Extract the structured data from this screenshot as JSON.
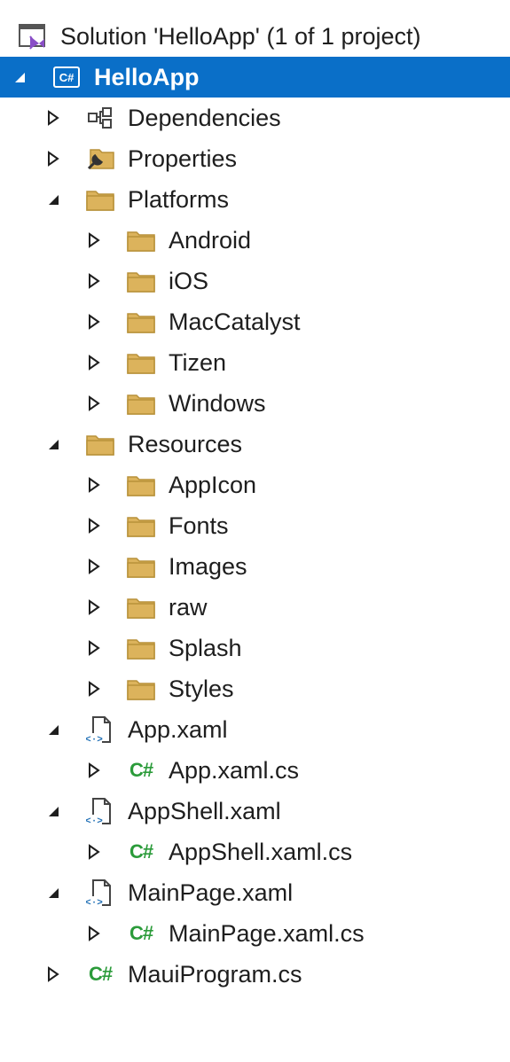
{
  "colors": {
    "selection": "#0a6fc8",
    "folder": "#dcb35c",
    "folder_edge": "#b8913a",
    "csharp": "#2b9b3a",
    "text": "#1e1e1e"
  },
  "tree": [
    {
      "label": "Solution 'HelloApp' (1 of 1 project)",
      "icon": "solution-icon",
      "toggle": "none",
      "level": 0,
      "selected": false
    },
    {
      "label": "HelloApp",
      "icon": "csharp-project-icon",
      "toggle": "expanded",
      "level": 0,
      "selected": true
    },
    {
      "label": "Dependencies",
      "icon": "dependencies-icon",
      "toggle": "collapsed",
      "level": 1,
      "selected": false
    },
    {
      "label": "Properties",
      "icon": "properties-icon",
      "toggle": "collapsed",
      "level": 1,
      "selected": false
    },
    {
      "label": "Platforms",
      "icon": "folder-icon",
      "toggle": "expanded",
      "level": 1,
      "selected": false
    },
    {
      "label": "Android",
      "icon": "folder-icon",
      "toggle": "collapsed",
      "level": 2,
      "selected": false
    },
    {
      "label": "iOS",
      "icon": "folder-icon",
      "toggle": "collapsed",
      "level": 2,
      "selected": false
    },
    {
      "label": "MacCatalyst",
      "icon": "folder-icon",
      "toggle": "collapsed",
      "level": 2,
      "selected": false
    },
    {
      "label": "Tizen",
      "icon": "folder-icon",
      "toggle": "collapsed",
      "level": 2,
      "selected": false
    },
    {
      "label": "Windows",
      "icon": "folder-icon",
      "toggle": "collapsed",
      "level": 2,
      "selected": false
    },
    {
      "label": "Resources",
      "icon": "folder-icon",
      "toggle": "expanded",
      "level": 1,
      "selected": false
    },
    {
      "label": "AppIcon",
      "icon": "folder-icon",
      "toggle": "collapsed",
      "level": 2,
      "selected": false
    },
    {
      "label": "Fonts",
      "icon": "folder-icon",
      "toggle": "collapsed",
      "level": 2,
      "selected": false
    },
    {
      "label": "Images",
      "icon": "folder-icon",
      "toggle": "collapsed",
      "level": 2,
      "selected": false
    },
    {
      "label": "raw",
      "icon": "folder-icon",
      "toggle": "collapsed",
      "level": 2,
      "selected": false
    },
    {
      "label": "Splash",
      "icon": "folder-icon",
      "toggle": "collapsed",
      "level": 2,
      "selected": false
    },
    {
      "label": "Styles",
      "icon": "folder-icon",
      "toggle": "collapsed",
      "level": 2,
      "selected": false
    },
    {
      "label": "App.xaml",
      "icon": "xaml-file-icon",
      "toggle": "expanded",
      "level": 1,
      "selected": false
    },
    {
      "label": "App.xaml.cs",
      "icon": "csharp-file-icon",
      "toggle": "collapsed",
      "level": 2,
      "selected": false
    },
    {
      "label": "AppShell.xaml",
      "icon": "xaml-file-icon",
      "toggle": "expanded",
      "level": 1,
      "selected": false
    },
    {
      "label": "AppShell.xaml.cs",
      "icon": "csharp-file-icon",
      "toggle": "collapsed",
      "level": 2,
      "selected": false
    },
    {
      "label": "MainPage.xaml",
      "icon": "xaml-file-icon",
      "toggle": "expanded",
      "level": 1,
      "selected": false
    },
    {
      "label": "MainPage.xaml.cs",
      "icon": "csharp-file-icon",
      "toggle": "collapsed",
      "level": 2,
      "selected": false
    },
    {
      "label": "MauiProgram.cs",
      "icon": "csharp-file-icon",
      "toggle": "collapsed",
      "level": 1,
      "selected": false
    }
  ]
}
